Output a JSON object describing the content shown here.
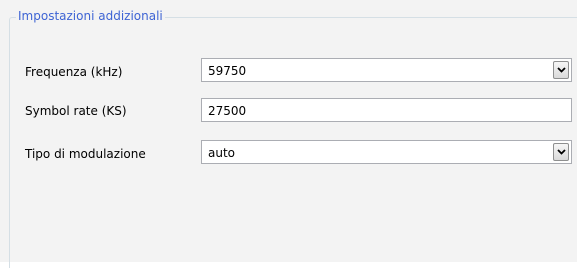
{
  "group": {
    "title": "Impostazioni addizionali"
  },
  "fields": {
    "frequency": {
      "label": "Frequenza (kHz)",
      "value": "59750",
      "icon": "chevron-down-icon"
    },
    "symbol_rate": {
      "label": "Symbol rate (KS)",
      "value": "27500"
    },
    "modulation": {
      "label": "Tipo di modulazione",
      "value": "auto",
      "icon": "chevron-down-icon"
    }
  },
  "colors": {
    "group_title": "#3e64d4",
    "panel_background": "#f3f3f3",
    "field_border": "#abadb3"
  }
}
